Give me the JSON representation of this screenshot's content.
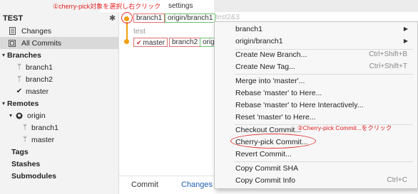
{
  "top": {
    "settings_label": "settings",
    "annotation1": "①cherry-pick対象を選択し右クリック"
  },
  "sidebar": {
    "repo_title": "TEST",
    "changes": "Changes",
    "all_commits": "All Commits",
    "branches_header": "Branches",
    "branches": [
      "branch1",
      "branch2",
      "master"
    ],
    "remotes_header": "Remotes",
    "remote_origin": "origin",
    "remote_branches": [
      "branch1",
      "master"
    ],
    "tags": "Tags",
    "stashes": "Stashes",
    "submodules": "Submodules"
  },
  "graph": {
    "row1_tags": [
      "branch1",
      "origin/branch1",
      "test2&3"
    ],
    "row2_message": "test",
    "row3_tags": [
      "master",
      "branch2",
      "origin"
    ]
  },
  "tabs": {
    "commit": "Commit",
    "changes": "Changes"
  },
  "menu": {
    "items": [
      {
        "label": "branch1",
        "shortcut": ""
      },
      {
        "label": "origin/branch1",
        "shortcut": ""
      },
      {
        "label": "Create New Branch...",
        "shortcut": "Ctrl+Shift+B"
      },
      {
        "label": "Create New Tag...",
        "shortcut": "Ctrl+Shift+T"
      },
      {
        "label": "Merge into 'master'...",
        "shortcut": ""
      },
      {
        "label": "Rebase 'master' to Here...",
        "shortcut": ""
      },
      {
        "label": "Rebase 'master' to Here Interactively...",
        "shortcut": ""
      },
      {
        "label": "Reset 'master' to Here...",
        "shortcut": ""
      },
      {
        "label": "Checkout Commit...",
        "shortcut": ""
      },
      {
        "label": "Cherry-pick Commit...",
        "shortcut": ""
      },
      {
        "label": "Revert Commit...",
        "shortcut": ""
      },
      {
        "label": "Copy Commit SHA",
        "shortcut": ""
      },
      {
        "label": "Copy Commit Info",
        "shortcut": "Ctrl+C"
      }
    ],
    "annotation2": "②Cherry-pick Commit...をクリック"
  },
  "colors": {
    "accent_blue": "#1f5fb0",
    "annotation_red": "#e02020",
    "graph_orange": "#f0a010"
  }
}
